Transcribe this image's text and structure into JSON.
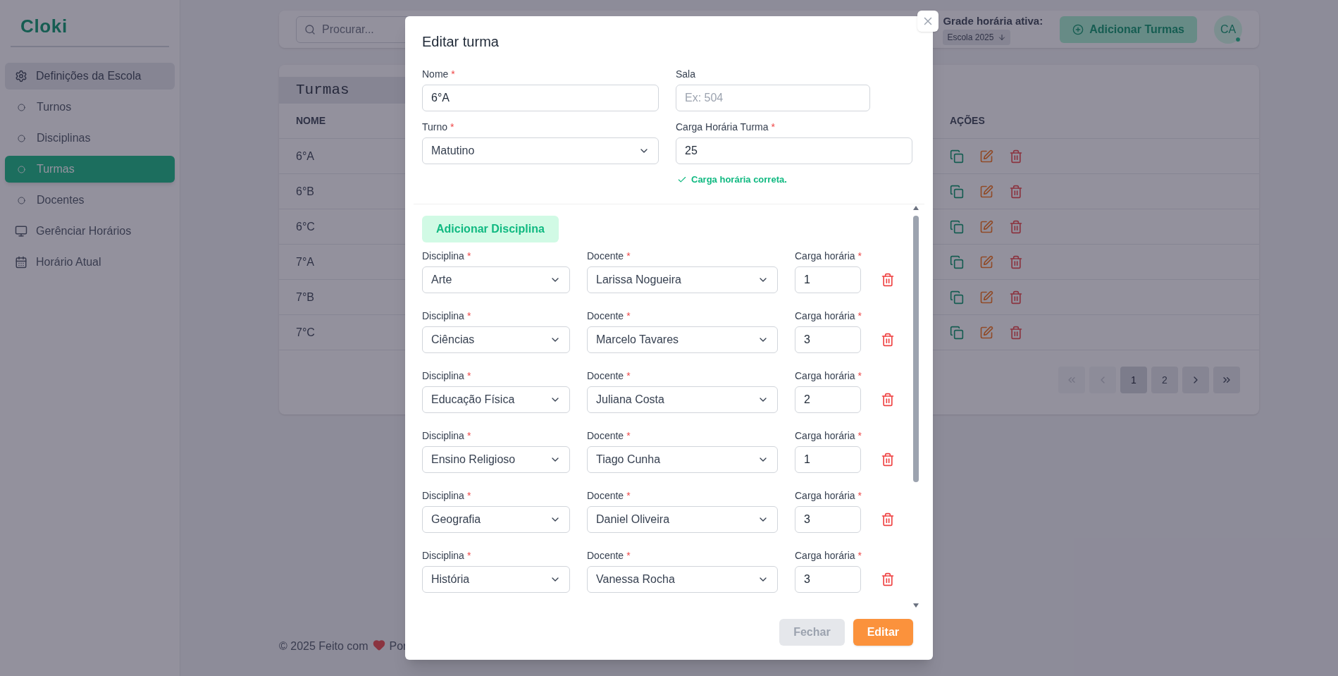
{
  "sidebar": {
    "logo": "Cloki",
    "items": [
      {
        "label": "Definições da Escola",
        "kind": "settings",
        "selected": false,
        "expanded": true
      },
      {
        "label": "Turnos",
        "kind": "bullet",
        "selected": false
      },
      {
        "label": "Disciplinas",
        "kind": "bullet",
        "selected": false
      },
      {
        "label": "Turmas",
        "kind": "bullet",
        "selected": true
      },
      {
        "label": "Docentes",
        "kind": "bullet",
        "selected": false
      },
      {
        "label": "Gerênciar Horários",
        "kind": "monitor",
        "selected": false
      },
      {
        "label": "Horário Atual",
        "kind": "calendar",
        "selected": false
      }
    ]
  },
  "header": {
    "search_placeholder": "Procurar...",
    "schedule_label": "Grade horária ativa:",
    "schedule_value": "Escola 2025",
    "add_button": "Adicionar Turmas",
    "avatar": "CA",
    "online": true
  },
  "table": {
    "title": "Turmas",
    "columns": [
      "NOME",
      "AÇÕES"
    ],
    "rows": [
      {
        "nome": "6°A"
      },
      {
        "nome": "6°B"
      },
      {
        "nome": "6°C"
      },
      {
        "nome": "7°A"
      },
      {
        "nome": "7°B"
      },
      {
        "nome": "7°C"
      }
    ],
    "pagination": [
      {
        "kind": "first",
        "selected": false,
        "disabled": true
      },
      {
        "kind": "prev",
        "selected": false,
        "disabled": true
      },
      {
        "kind": "page",
        "label": "1",
        "selected": true,
        "disabled": false
      },
      {
        "kind": "page",
        "label": "2",
        "selected": false,
        "disabled": false
      },
      {
        "kind": "next",
        "selected": false,
        "disabled": false
      },
      {
        "kind": "last",
        "selected": false,
        "disabled": false
      }
    ]
  },
  "footer": {
    "text": "© 2025 Feito com",
    "by": "Por"
  },
  "modal": {
    "title": "Editar turma",
    "fields": [
      {
        "label": "Nome",
        "mark": "*",
        "kind": "input",
        "value": "6°A"
      },
      {
        "label": "Sala",
        "kind": "input",
        "placeholder": "Ex: 504"
      },
      {
        "label": "Turno",
        "mark": "*",
        "kind": "select",
        "value": "Matutino"
      },
      {
        "label": "Carga Horária Turma",
        "mark": "*",
        "kind": "input",
        "value": "25"
      }
    ],
    "validation": {
      "text": "Carga horária correta.",
      "valid": true
    },
    "add_button": "Adicionar Disciplina",
    "rows": [
      {
        "disciplina": {
          "label": "Disciplina",
          "mark": "*",
          "value": "Arte"
        },
        "docente": {
          "label": "Docente",
          "mark": "*",
          "value": "Larissa Nogueira"
        },
        "carga": {
          "label": "Carga horária",
          "mark": "*",
          "value": "1"
        }
      },
      {
        "disciplina": {
          "label": "Disciplina",
          "mark": "*",
          "value": "Ciências"
        },
        "docente": {
          "label": "Docente",
          "mark": "*",
          "value": "Marcelo Tavares"
        },
        "carga": {
          "label": "Carga horária",
          "mark": "*",
          "value": "3"
        }
      },
      {
        "disciplina": {
          "label": "Disciplina",
          "mark": "*",
          "value": "Educação Física"
        },
        "docente": {
          "label": "Docente",
          "mark": "*",
          "value": "Juliana Costa"
        },
        "carga": {
          "label": "Carga horária",
          "mark": "*",
          "value": "2"
        }
      },
      {
        "disciplina": {
          "label": "Disciplina",
          "mark": "*",
          "value": "Ensino Religioso"
        },
        "docente": {
          "label": "Docente",
          "mark": "*",
          "value": "Tiago Cunha"
        },
        "carga": {
          "label": "Carga horária",
          "mark": "*",
          "value": "1"
        }
      },
      {
        "disciplina": {
          "label": "Disciplina",
          "mark": "*",
          "value": "Geografia"
        },
        "docente": {
          "label": "Docente",
          "mark": "*",
          "value": "Daniel Oliveira"
        },
        "carga": {
          "label": "Carga horária",
          "mark": "*",
          "value": "3"
        }
      },
      {
        "disciplina": {
          "label": "Disciplina",
          "mark": "*",
          "value": "História"
        },
        "docente": {
          "label": "Docente",
          "mark": "*",
          "value": "Vanessa Rocha"
        },
        "carga": {
          "label": "Carga horária",
          "mark": "*",
          "value": "3"
        }
      }
    ],
    "buttons": [
      {
        "label": "Fechar",
        "kind": "secondary"
      },
      {
        "label": "Editar",
        "kind": "primary"
      }
    ]
  }
}
